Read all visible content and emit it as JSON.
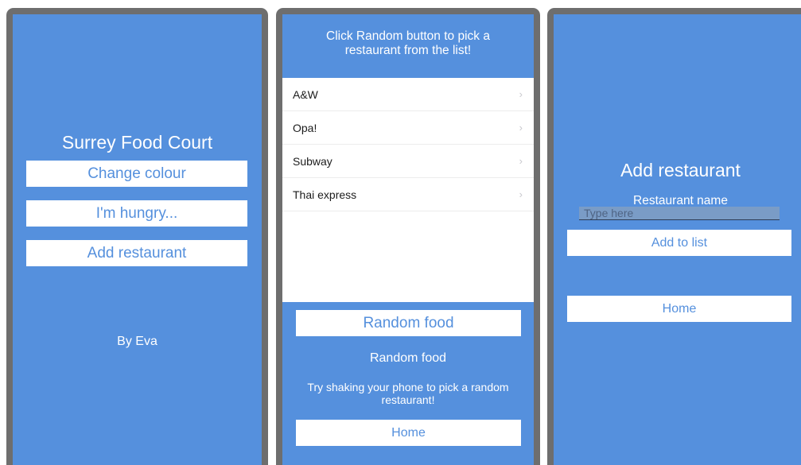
{
  "screen_home": {
    "title": "Surrey Food Court",
    "buttons": [
      "Change colour",
      "I'm hungry...",
      "Add restaurant"
    ],
    "author": "By Eva"
  },
  "screen_random": {
    "header": "Click Random button to pick a restaurant from the list!",
    "restaurants": [
      {
        "name": "A&W"
      },
      {
        "name": "Opa!"
      },
      {
        "name": "Subway"
      },
      {
        "name": "Thai express"
      }
    ],
    "random_button": "Random food",
    "result_label": "Random food",
    "hint": "Try shaking your phone to pick a random restaurant!",
    "home_button": "Home"
  },
  "screen_add": {
    "title": "Add restaurant",
    "field_label": "Restaurant name",
    "placeholder": "Type here",
    "add_button": "Add to list",
    "home_button": "Home"
  },
  "colors": {
    "background": "#5590dd",
    "frame": "#6e6e6e",
    "button_bg": "#ffffff",
    "button_text": "#5590dd"
  },
  "icons": {
    "row_disclosure": "chevron-right-icon"
  }
}
